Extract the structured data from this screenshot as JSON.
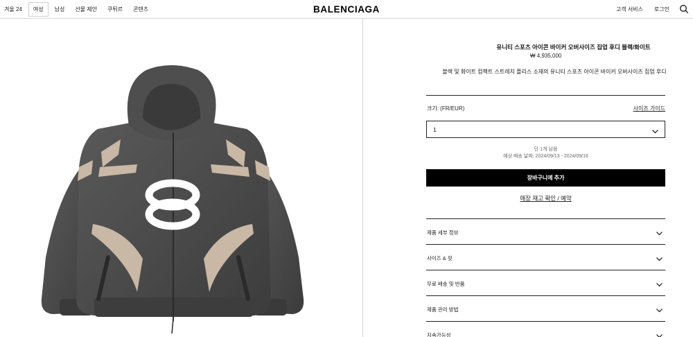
{
  "header": {
    "nav_left": [
      "겨울 24",
      "여성",
      "남성",
      "선물 제안",
      "쿠튀르",
      "콘텐츠"
    ],
    "active_nav": "여성",
    "logo": "BALENCIAGA",
    "nav_right": [
      "고객 서비스",
      "로그인"
    ]
  },
  "product": {
    "title": "유니티 스포츠 아이콘 바이커 오버사이즈 집업 후디 블랙/화이트",
    "price": "₩ 4,935,000",
    "description": "블랙 및 화이트 컴팩트 스트레치 플리스 소재의 유니티 스포츠 아이콘 바이커 오버사이즈 집업 후디",
    "size_label": "크기: (FR/EUR)",
    "size_guide": "사이즈 가이드",
    "size_value": "1",
    "stock_left": "단 1개 남음",
    "delivery": "예상 배송 날짜: 2024/09/13 - 2024/09/16",
    "add_to_cart": "장바구니에 추가",
    "store_check": "매장 재고 확인 / 예약"
  },
  "accordion": [
    "제품 세부 정보",
    "사이즈 & 핏",
    "무료 배송 및 반품",
    "제품 관리 방법",
    "지속가능성"
  ],
  "colors": {
    "garment_dark": "#4a4a4a",
    "garment_panel": "#c9b8a6",
    "logo_white": "#ffffff",
    "button_bg": "#000000"
  },
  "icons": [
    "search-icon",
    "chevron-down-icon"
  ]
}
